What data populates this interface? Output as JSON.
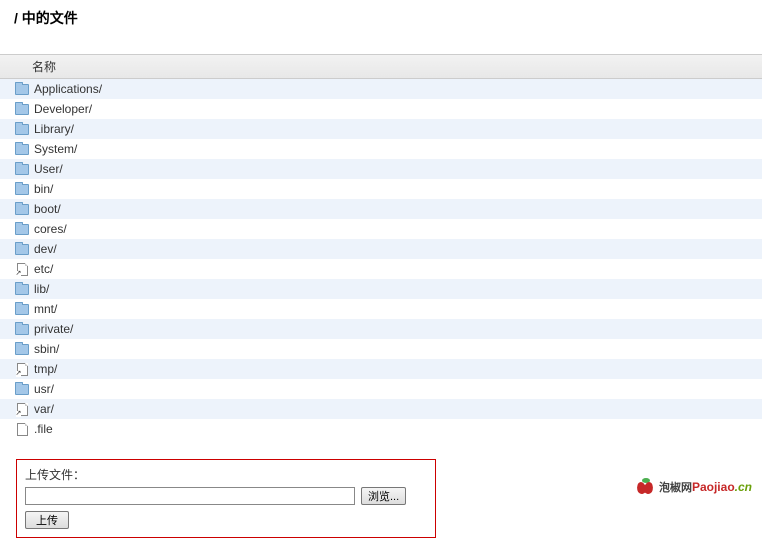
{
  "page": {
    "title": "/ 中的文件",
    "column_header": "名称"
  },
  "files": [
    {
      "name": "Applications/",
      "type": "folder"
    },
    {
      "name": "Developer/",
      "type": "folder"
    },
    {
      "name": "Library/",
      "type": "folder"
    },
    {
      "name": "System/",
      "type": "folder"
    },
    {
      "name": "User/",
      "type": "folder"
    },
    {
      "name": "bin/",
      "type": "folder"
    },
    {
      "name": "boot/",
      "type": "folder"
    },
    {
      "name": "cores/",
      "type": "folder"
    },
    {
      "name": "dev/",
      "type": "folder"
    },
    {
      "name": "etc/",
      "type": "link"
    },
    {
      "name": "lib/",
      "type": "folder"
    },
    {
      "name": "mnt/",
      "type": "folder"
    },
    {
      "name": "private/",
      "type": "folder"
    },
    {
      "name": "sbin/",
      "type": "folder"
    },
    {
      "name": "tmp/",
      "type": "link"
    },
    {
      "name": "usr/",
      "type": "folder"
    },
    {
      "name": "var/",
      "type": "link"
    },
    {
      "name": ".file",
      "type": "file"
    }
  ],
  "upload": {
    "label": "上传文件：",
    "browse_btn": "浏览...",
    "submit_btn": "上传",
    "value": ""
  },
  "watermark": {
    "cn": "泡椒网",
    "en_red": "Paojiao",
    "en_grn": ".cn"
  }
}
